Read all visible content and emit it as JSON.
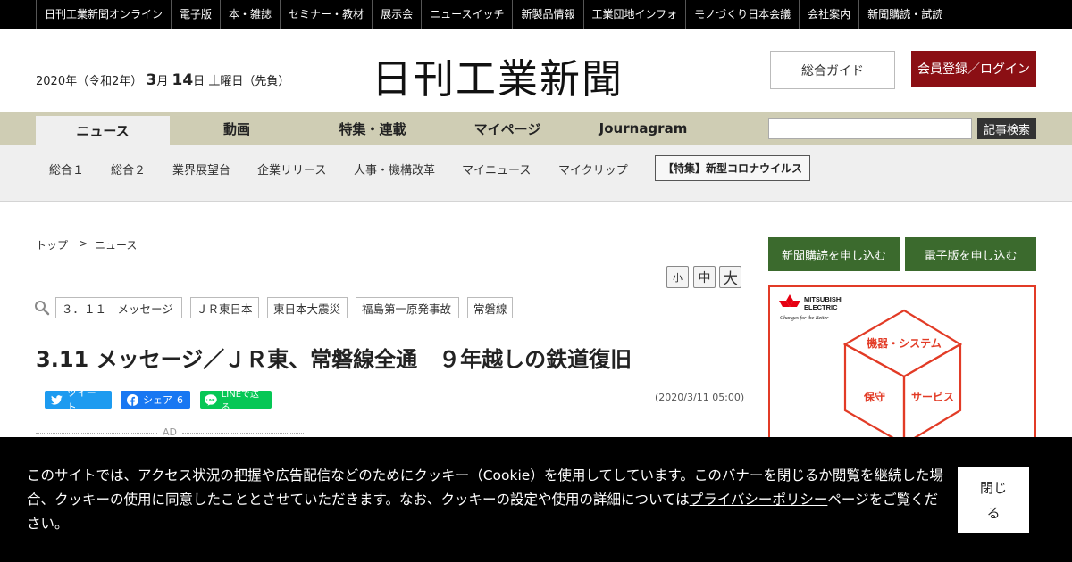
{
  "topnav": [
    "日刊工業新聞オンライン",
    "電子版",
    "本・雑誌",
    "セミナー・教材",
    "展示会",
    "ニュースイッチ",
    "新製品情報",
    "工業団地インフォ",
    "モノづくり日本会議",
    "会社案内",
    "新聞購読・試読"
  ],
  "header": {
    "date_prefix": "2020年（令和2年）",
    "month": "3",
    "month_unit": "月",
    "day": "14",
    "day_unit": "日",
    "weekday": "土曜日（先負）",
    "logo": "日刊工業新聞",
    "guide_label": "総合ガイド",
    "login_label": "会員登録／ログイン"
  },
  "mainnav": [
    "ニュース",
    "動画",
    "特集・連載",
    "マイページ",
    "Journagram"
  ],
  "search": {
    "button": "記事検索",
    "placeholder": ""
  },
  "subnav": {
    "items": [
      "総合１",
      "総合２",
      "業界展望台",
      "企業リリース",
      "人事・機構改革",
      "マイニュース",
      "マイクリップ"
    ],
    "special": "【特集】新型コロナウイルス"
  },
  "breadcrumb": {
    "home": "トップ",
    "separator": ">",
    "current": "ニュース"
  },
  "font_size": [
    "小",
    "中",
    "大"
  ],
  "tags": [
    "３．１１　メッセージ",
    "ＪＲ東日本",
    "東日本大震災",
    "福島第一原発事故",
    "常磐線"
  ],
  "article": {
    "title": "3.11 メッセージ／ＪＲ東、常磐線全通　９年越しの鉄道復旧",
    "date": "(2020/3/11 05:00)"
  },
  "social": {
    "tweet": "ツイート",
    "share": "シェア",
    "share_count": "6",
    "line": "LINEで送る"
  },
  "ad": {
    "label": "AD",
    "brand_line1": "MITSUBISHI",
    "brand_line2": "ELECTRIC",
    "brand_tagline": "Changes for the Better",
    "cube_top": "機器・システム",
    "cube_left": "保守",
    "cube_right": "サービス"
  },
  "sidebar": {
    "subscribe": "新聞購読を申し込む",
    "digital": "電子版を申し込む"
  },
  "cookie": {
    "text_before": "このサイトでは、アクセス状況の把握や広告配信などのためにクッキー（Cookie）を使用してしています。このバナーを閉じるか閲覧を継続した場合、クッキーの使用に同意したこととさせていただきます。なお、クッキーの設定や使用の詳細については",
    "link": "プライバシーポリシー",
    "text_after": "ページをご覧ください。",
    "close_line1": "閉じ",
    "close_line2": "る"
  },
  "colors": {
    "topbar": "#000000",
    "nav": "#cfcdb4",
    "login": "#8b0f14",
    "sidebar_button": "#3b6a2d",
    "ad_border": "#e23b26",
    "tweet": "#1d9bf0",
    "facebook": "#1877f2",
    "line": "#06c755"
  }
}
